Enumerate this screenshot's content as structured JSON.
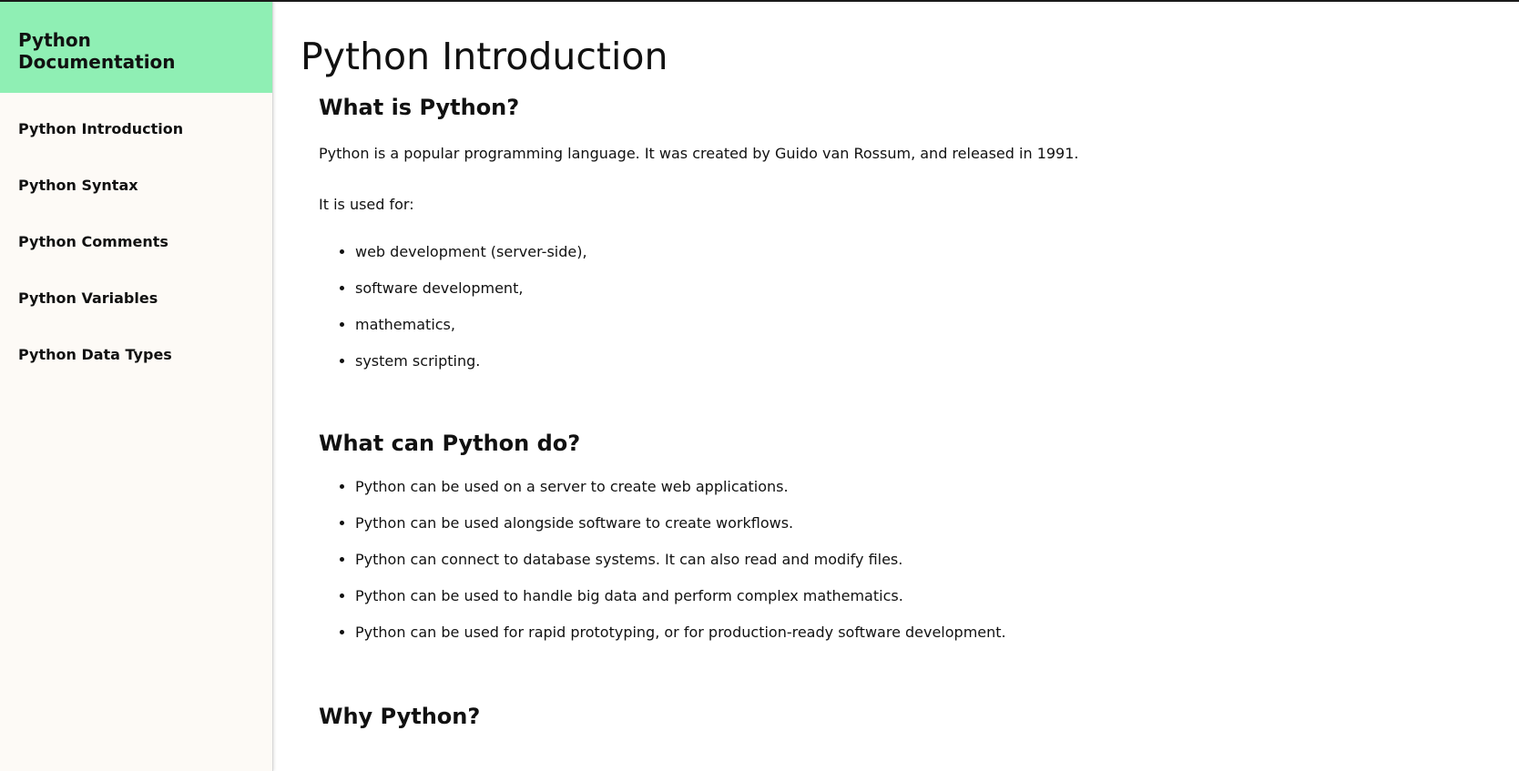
{
  "sidebar": {
    "title": "Python Documentation",
    "items": [
      {
        "label": "Python Introduction"
      },
      {
        "label": "Python Syntax"
      },
      {
        "label": "Python Comments"
      },
      {
        "label": "Python Variables"
      },
      {
        "label": "Python Data Types"
      }
    ]
  },
  "main": {
    "title": "Python Introduction",
    "sections": [
      {
        "heading": "What is Python?",
        "paragraphs": [
          "Python is a popular programming language. It was created by Guido van Rossum, and released in 1991.",
          "It is used for:"
        ],
        "items": [
          "web development (server-side),",
          "software development,",
          "mathematics,",
          "system scripting."
        ]
      },
      {
        "heading": "What can Python do?",
        "items": [
          "Python can be used on a server to create web applications.",
          "Python can be used alongside software to create workflows.",
          "Python can connect to database systems. It can also read and modify files.",
          "Python can be used to handle big data and perform complex mathematics.",
          "Python can be used for rapid prototyping, or for production-ready software development."
        ]
      },
      {
        "heading": "Why Python?"
      }
    ]
  },
  "colors": {
    "sidebar_header_bg": "#8fefb4",
    "sidebar_bg": "#fdfaf6",
    "text": "#111111"
  }
}
